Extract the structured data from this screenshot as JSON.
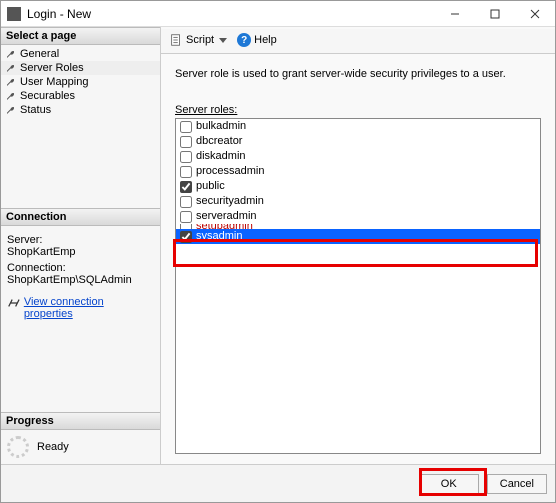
{
  "window": {
    "title": "Login - New"
  },
  "sidebar": {
    "select_page_header": "Select a page",
    "pages": [
      {
        "label": "General",
        "selected": false
      },
      {
        "label": "Server Roles",
        "selected": true
      },
      {
        "label": "User Mapping",
        "selected": false
      },
      {
        "label": "Securables",
        "selected": false
      },
      {
        "label": "Status",
        "selected": false
      }
    ],
    "connection_header": "Connection",
    "server_label": "Server:",
    "server_value": "ShopKartEmp",
    "connection_label": "Connection:",
    "connection_value": "ShopKartEmp\\SQLAdmin",
    "view_conn_props": "View connection properties",
    "progress_header": "Progress",
    "progress_status": "Ready"
  },
  "toolbar": {
    "script": "Script",
    "help": "Help"
  },
  "main": {
    "description": "Server role is used to grant server-wide security privileges to a user.",
    "server_roles_label": "Server roles:",
    "roles": [
      {
        "name": "bulkadmin",
        "checked": false
      },
      {
        "name": "dbcreator",
        "checked": false
      },
      {
        "name": "diskadmin",
        "checked": false
      },
      {
        "name": "processadmin",
        "checked": false
      },
      {
        "name": "public",
        "checked": true
      },
      {
        "name": "securityadmin",
        "checked": false
      },
      {
        "name": "serveradmin",
        "checked": false
      },
      {
        "name": "setupadmin",
        "checked": false,
        "partial": true
      },
      {
        "name": "sysadmin",
        "checked": true,
        "selected": true
      }
    ]
  },
  "footer": {
    "ok": "OK",
    "cancel": "Cancel"
  }
}
